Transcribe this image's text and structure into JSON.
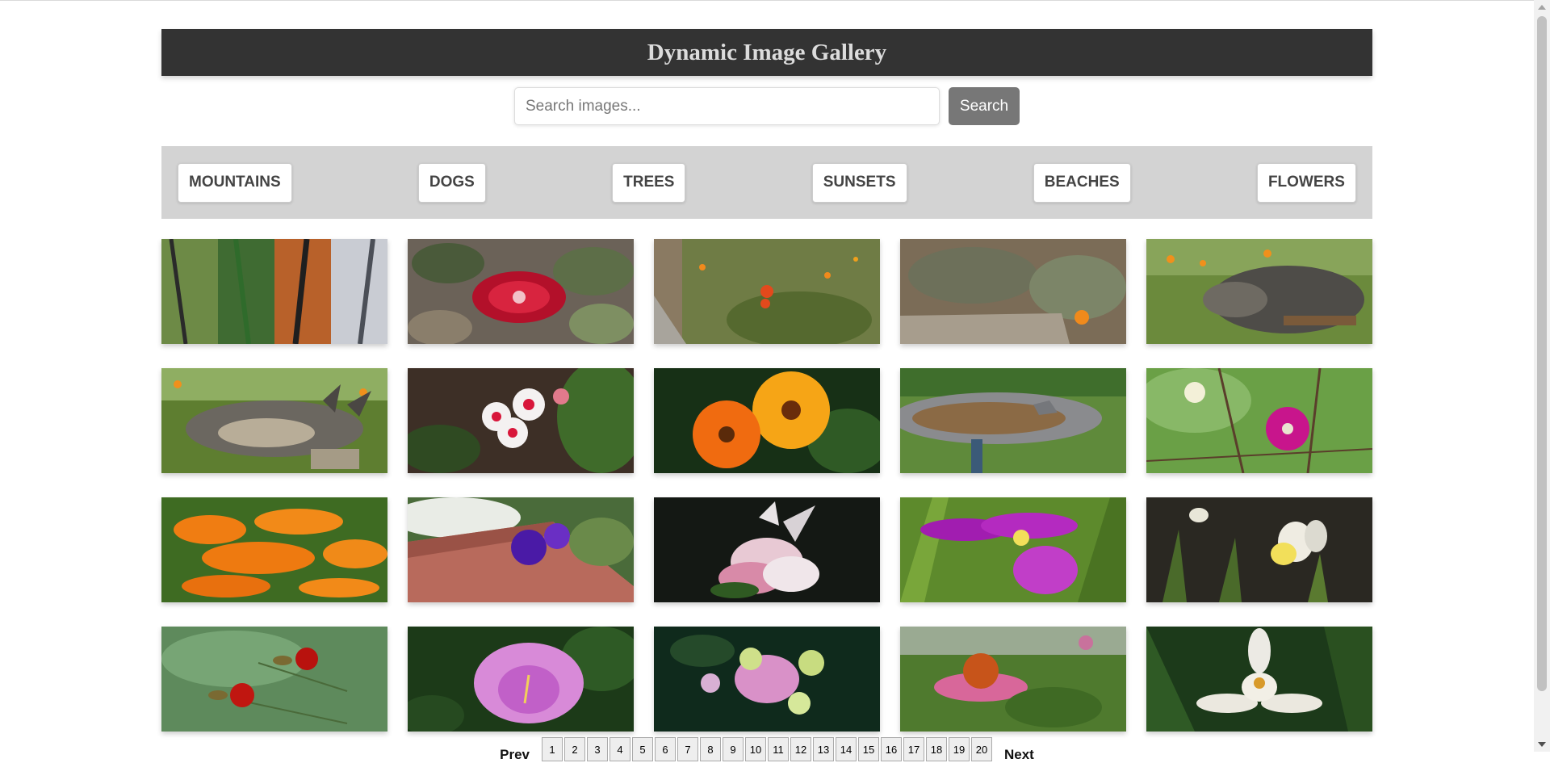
{
  "gallery": {
    "title": "Dynamic Image Gallery",
    "search_placeholder": "Search images...",
    "search_button": "Search"
  },
  "categories": [
    "MOUNTAINS",
    "DOGS",
    "TREES",
    "SUNSETS",
    "BEACHES",
    "FLOWERS"
  ],
  "images": [
    {
      "subject": "garden stakes"
    },
    {
      "subject": "red bottlebrush flower"
    },
    {
      "subject": "orange wildflowers"
    },
    {
      "subject": "garden ground with orange flower"
    },
    {
      "subject": "dog in garden"
    },
    {
      "subject": "dog lying in garden"
    },
    {
      "subject": "red and white geraniums"
    },
    {
      "subject": "orange calendula flowers"
    },
    {
      "subject": "bird bath"
    },
    {
      "subject": "magenta clematis"
    },
    {
      "subject": "orange butterfly weed"
    },
    {
      "subject": "purple petunias by brick"
    },
    {
      "subject": "pink and white tulips"
    },
    {
      "subject": "purple iris"
    },
    {
      "subject": "white iris"
    },
    {
      "subject": "red wildflowers"
    },
    {
      "subject": "pink tulip"
    },
    {
      "subject": "pink bougainvillea"
    },
    {
      "subject": "echinacea coneflower"
    },
    {
      "subject": "white orchid"
    }
  ],
  "pagination": {
    "prev": "Prev",
    "next": "Next",
    "pages": [
      "1",
      "2",
      "3",
      "4",
      "5",
      "6",
      "7",
      "8",
      "9",
      "10",
      "11",
      "12",
      "13",
      "14",
      "15",
      "16",
      "17",
      "18",
      "19",
      "20"
    ]
  },
  "colors": {
    "header_bg": "#333333",
    "category_bar_bg": "#d3d3d3",
    "search_button_bg": "#777777"
  }
}
